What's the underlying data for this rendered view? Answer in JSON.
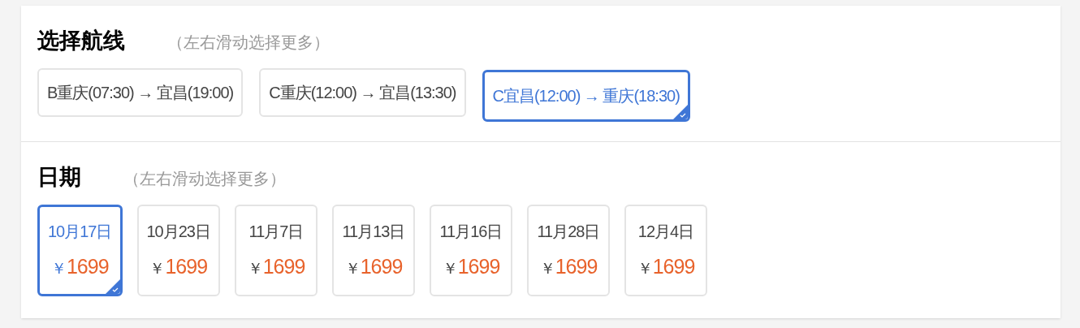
{
  "routes_section": {
    "title": "选择航线",
    "hint": "（左右滑动选择更多）",
    "routes": [
      {
        "label": "B重庆(07:30) → 宜昌(19:00)",
        "selected": false
      },
      {
        "label": "C重庆(12:00) → 宜昌(13:30)",
        "selected": false
      },
      {
        "label": "C宜昌(12:00) → 重庆(18:30)",
        "selected": true
      }
    ]
  },
  "dates_section": {
    "title": "日期",
    "hint": "（左右滑动选择更多）",
    "dates": [
      {
        "date": "10月17日",
        "currency": "￥",
        "price": "1699",
        "selected": true
      },
      {
        "date": "10月23日",
        "currency": "￥",
        "price": "1699",
        "selected": false
      },
      {
        "date": "11月7日",
        "currency": "￥",
        "price": "1699",
        "selected": false
      },
      {
        "date": "11月13日",
        "currency": "￥",
        "price": "1699",
        "selected": false
      },
      {
        "date": "11月16日",
        "currency": "￥",
        "price": "1699",
        "selected": false
      },
      {
        "date": "11月28日",
        "currency": "￥",
        "price": "1699",
        "selected": false
      },
      {
        "date": "12月4日",
        "currency": "￥",
        "price": "1699",
        "selected": false
      }
    ]
  }
}
